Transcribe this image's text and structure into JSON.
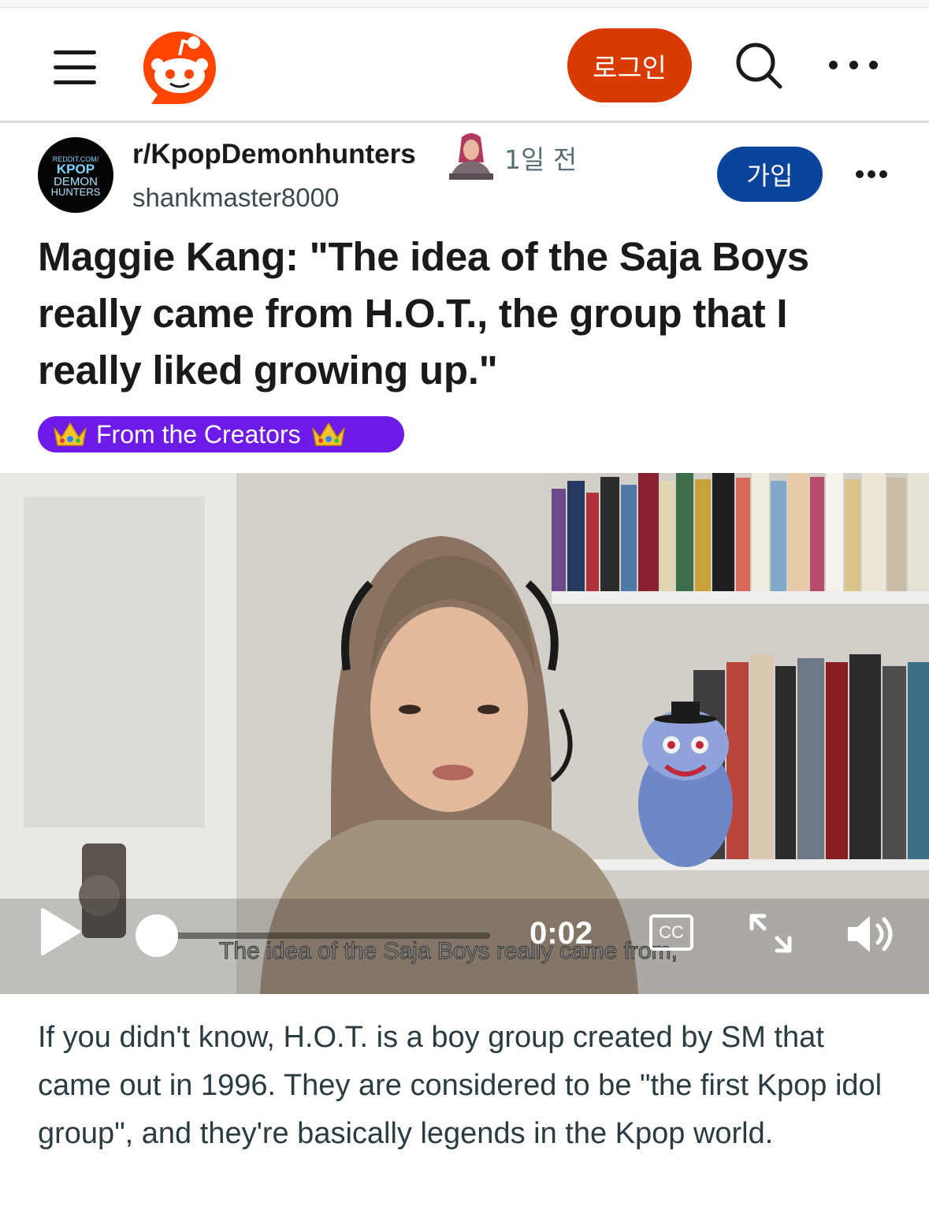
{
  "header": {
    "menu_icon": "hamburger-icon",
    "logo_icon": "reddit-snoo-icon",
    "login_label": "로그인",
    "search_icon": "search-icon",
    "more_icon": "more-horizontal-icon"
  },
  "post": {
    "subreddit": "r/KpopDemonhunters",
    "subreddit_avatar_text": [
      "REDDIT.COM/",
      "KPOP",
      "DEMON",
      "HUNTERS"
    ],
    "time_ago": "1일 전",
    "username": "shankmaster8000",
    "join_label": "가입",
    "title": "Maggie Kang: \"The idea of the Saja Boys really came from H.O.T., the group that I really liked growing up.\"",
    "flair_text": "From the Creators",
    "flair_color": "#6e1ae8",
    "body": "If you didn't know, H.O.T. is a boy group created by SM that came out in 1996. They are considered to be \"the first Kpop idol group\", and they're basically legends in the Kpop world."
  },
  "video": {
    "time": "0:02",
    "cc_label": "CC",
    "subtitle": "The idea of the Saja Boys really came from,",
    "progress": 0.0
  },
  "colors": {
    "login": "#d93a00",
    "join": "#0a449b",
    "brand": "#ff4500"
  }
}
